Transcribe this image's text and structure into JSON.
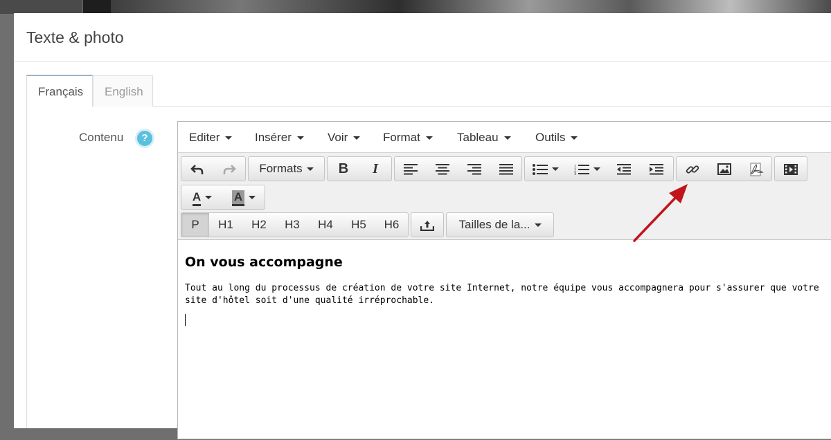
{
  "modal": {
    "title": "Texte & photo"
  },
  "tabs": [
    {
      "label": "Français",
      "active": true
    },
    {
      "label": "English",
      "active": false
    }
  ],
  "field": {
    "label": "Contenu",
    "help": "?"
  },
  "menubar": [
    "Editer",
    "Insérer",
    "Voir",
    "Format",
    "Tableau",
    "Outils"
  ],
  "toolbar": {
    "formats_label": "Formats",
    "bold": "B",
    "italic": "I",
    "text_color": "A",
    "bg_color": "A",
    "block_buttons": [
      "P",
      "H1",
      "H2",
      "H3",
      "H4",
      "H5",
      "H6"
    ],
    "font_size_label": "Tailles de la...",
    "icons": [
      "undo-icon",
      "redo-icon",
      "align-left-icon",
      "align-center-icon",
      "align-right-icon",
      "align-justify-icon",
      "bullet-list-icon",
      "numbered-list-icon",
      "outdent-icon",
      "indent-icon",
      "link-icon",
      "image-icon",
      "pdf-icon",
      "media-icon",
      "upload-icon"
    ]
  },
  "content": {
    "heading": "On vous accompagne",
    "paragraph": "Tout au long du processus de création de votre site Internet, notre équipe vous accompagnera pour s'assurer que votre site d'hôtel soit d'une qualité irréprochable."
  },
  "colors": {
    "help_badge": "#5bc0de",
    "arrow": "#c0151b",
    "active_tab_border": "#9fb4c6"
  }
}
